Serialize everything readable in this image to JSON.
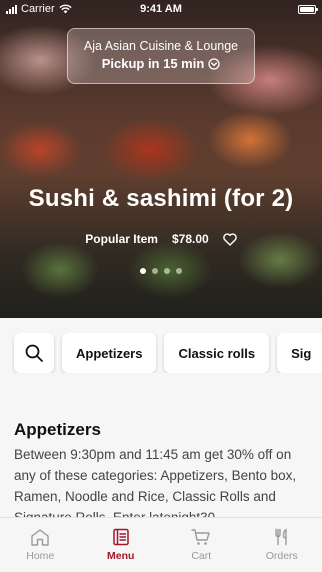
{
  "status_bar": {
    "carrier": "Carrier",
    "time": "9:41 AM"
  },
  "store": {
    "name": "Aja Asian Cuisine & Lounge",
    "pickup": "Pickup in 15 min"
  },
  "featured": {
    "title": "Sushi & sashimi (for 2)",
    "badge": "Popular Item",
    "price": "$78.00",
    "carousel_count": 4,
    "carousel_active_index": 0
  },
  "categories": [
    "Appetizers",
    "Classic rolls",
    "Sig"
  ],
  "section": {
    "title": "Appetizers",
    "description": "Between 9:30pm and 11:45 am get 30% off on any of these categories: Appetizers, Bento box, Ramen, Noodle and Rice, Classic Rolls and Signature Rolls. Enter latenight30"
  },
  "tabs": [
    {
      "label": "Home",
      "icon": "home-icon",
      "active": false
    },
    {
      "label": "Menu",
      "icon": "menu-book-icon",
      "active": true
    },
    {
      "label": "Cart",
      "icon": "cart-icon",
      "active": false
    },
    {
      "label": "Orders",
      "icon": "utensils-icon",
      "active": false
    }
  ],
  "colors": {
    "accent": "#a0172b",
    "background": "#f7f6f6",
    "inactive_tab": "#9a9a9a"
  }
}
